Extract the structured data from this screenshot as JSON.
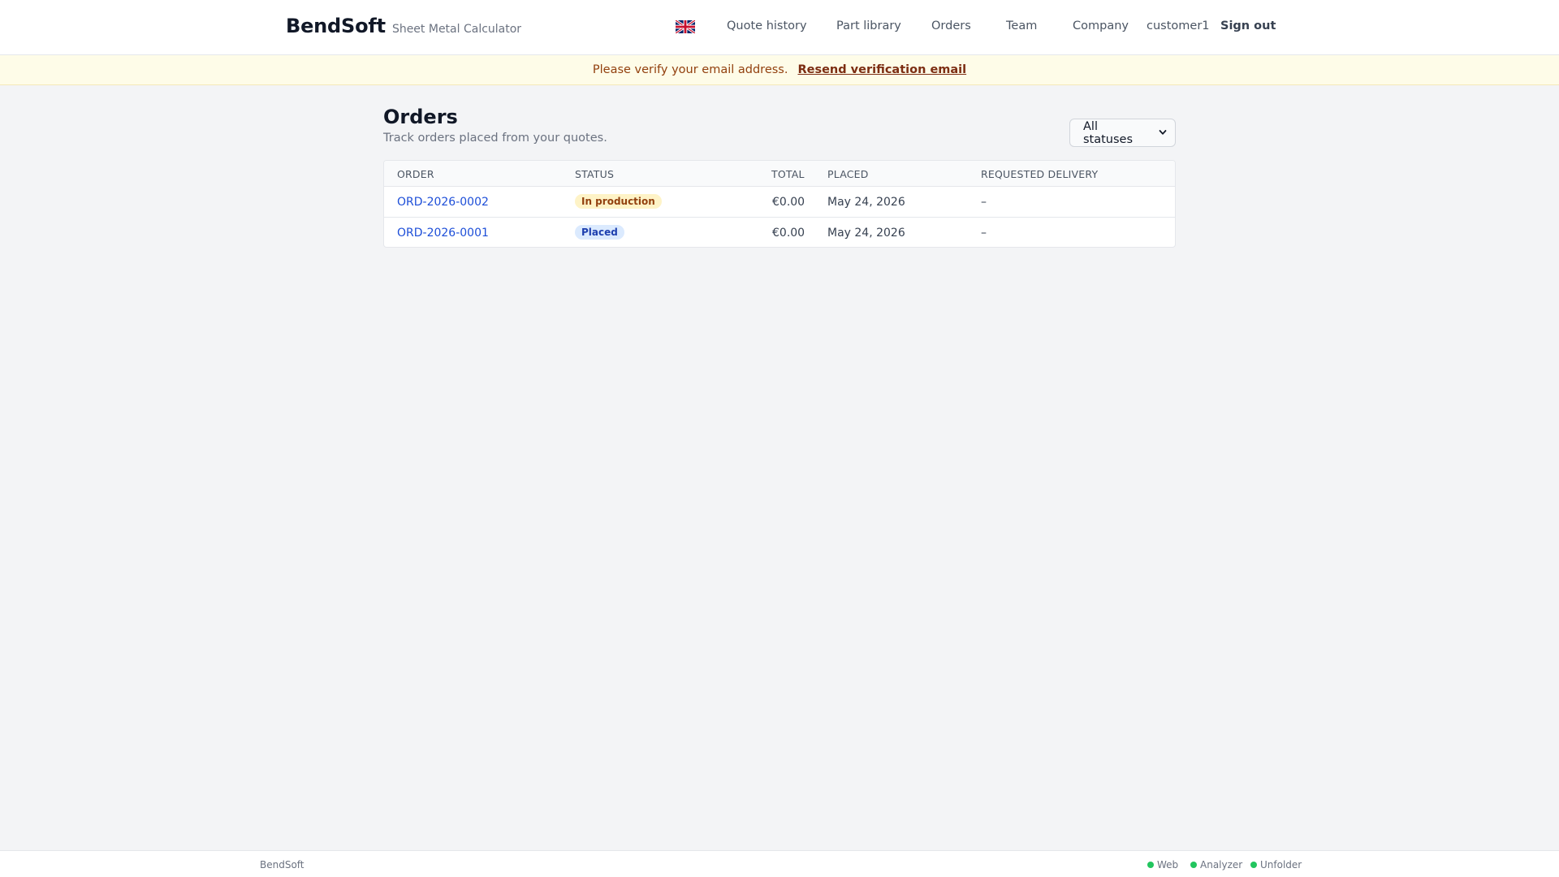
{
  "header": {
    "brand_name": "BendSoft",
    "brand_subtitle": "Sheet Metal Calculator",
    "language_icon": "uk-flag-icon",
    "nav": {
      "quote_history": "Quote history",
      "part_library": "Part library",
      "orders": "Orders",
      "team": "Team",
      "company": "Company",
      "user": "customer1",
      "sign_out": "Sign out"
    }
  },
  "banner": {
    "message": "Please verify your email address.",
    "link": "Resend verification email"
  },
  "main": {
    "title": "Orders",
    "subtitle": "Track orders placed from your quotes.",
    "status_filter": {
      "selected": "All statuses"
    },
    "table": {
      "columns": {
        "order": "Order",
        "status": "Status",
        "total": "Total",
        "placed": "Placed",
        "requested_delivery": "Requested delivery"
      },
      "rows": [
        {
          "order": "ORD-2026-0002",
          "status": "In production",
          "total": "€0.00",
          "placed": "May 24, 2026",
          "requested_delivery": "–"
        },
        {
          "order": "ORD-2026-0001",
          "status": "Placed",
          "total": "€0.00",
          "placed": "May 24, 2026",
          "requested_delivery": "–"
        }
      ]
    }
  },
  "footer": {
    "brand": "BendSoft",
    "services": [
      "Web",
      "Analyzer",
      "Unfolder"
    ],
    "status_color": "#22c55e"
  },
  "colors": {
    "link": "#1d4ed8",
    "banner_bg": "#fefce8",
    "badge_in_production_bg": "#fef3c7",
    "badge_placed_bg": "#dbeafe"
  }
}
